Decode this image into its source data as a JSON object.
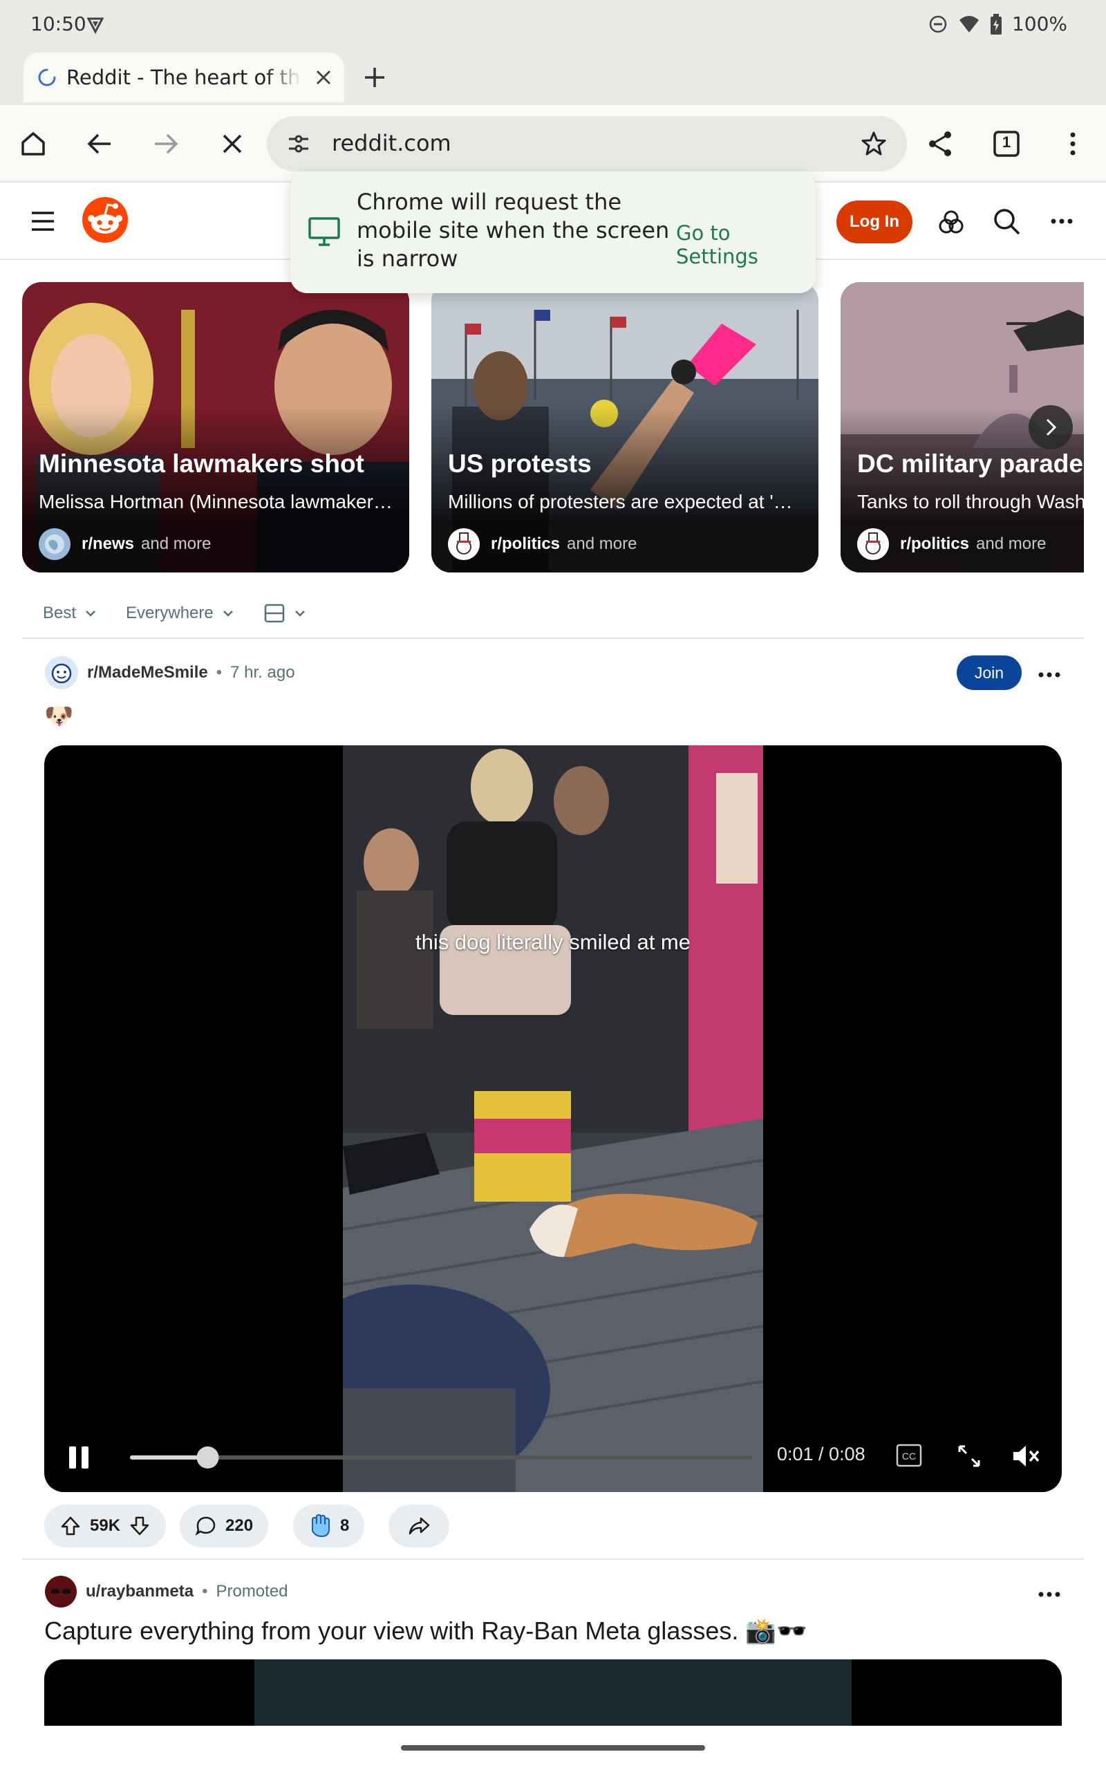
{
  "status_bar": {
    "time": "10:50",
    "battery": "100%"
  },
  "browser": {
    "tab_title": "Reddit - The heart of the internet",
    "tab_count": "1",
    "url": "reddit.com"
  },
  "toast": {
    "message": "Chrome will request the mobile site when the screen is narrow",
    "action": "Go to Settings"
  },
  "reddit_header": {
    "login_label": "Log In"
  },
  "trending": [
    {
      "title": "Minnesota lawmakers shot",
      "subtitle": "Melissa Hortman (Minnesota lawmaker…",
      "subreddit": "r/news",
      "more": "and more"
    },
    {
      "title": "US protests",
      "subtitle": "Millions of protesters are expected at '…",
      "subreddit": "r/politics",
      "more": "and more"
    },
    {
      "title": "DC military parade",
      "subtitle": "Tanks to roll through Washington",
      "subreddit": "r/politics",
      "more": "and more"
    }
  ],
  "sort": {
    "sort_label": "Best",
    "location_label": "Everywhere"
  },
  "post": {
    "subreddit": "r/MadeMeSmile",
    "age": "7 hr. ago",
    "join_label": "Join",
    "emoji": "🐶",
    "video_caption": "this dog literally smiled at me",
    "time_display": "0:01 / 0:08",
    "progress": 0.125,
    "cc_label": "CC",
    "votes": "59K",
    "comments": "220",
    "awards": "8"
  },
  "ad": {
    "user": "u/raybanmeta",
    "label": "Promoted",
    "title": "Capture everything from your view with Ray-Ban Meta glasses. 📸🕶️"
  },
  "colors": {
    "accent": "#d93a00",
    "join": "#0a449b",
    "toast_link": "#1f7a4b"
  }
}
